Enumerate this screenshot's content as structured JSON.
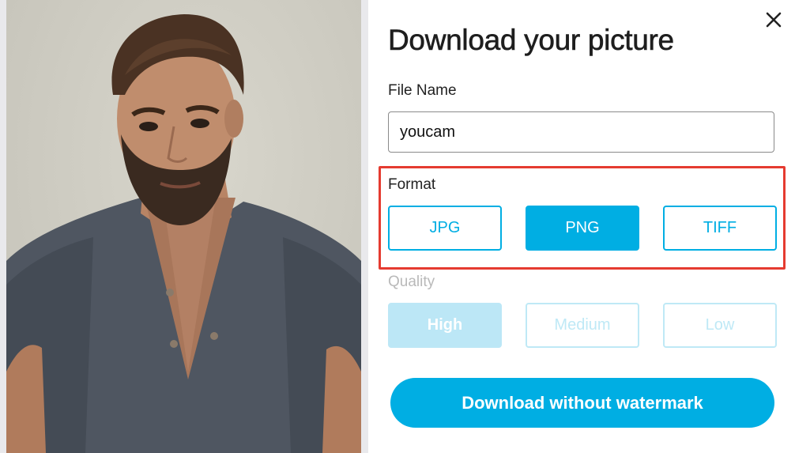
{
  "dialog": {
    "title": "Download your picture",
    "file_name_label": "File Name",
    "file_name_value": "youcam",
    "format_label": "Format",
    "format_options": [
      "JPG",
      "PNG",
      "TIFF"
    ],
    "format_selected": "PNG",
    "quality_label": "Quality",
    "quality_options": [
      "High",
      "Medium",
      "Low"
    ],
    "quality_selected": "High",
    "download_button": "Download without watermark"
  },
  "colors": {
    "accent": "#00aee3",
    "highlight_box": "#e53b30",
    "disabled_accent": "#bce7f6"
  },
  "icons": {
    "close": "close-icon"
  }
}
